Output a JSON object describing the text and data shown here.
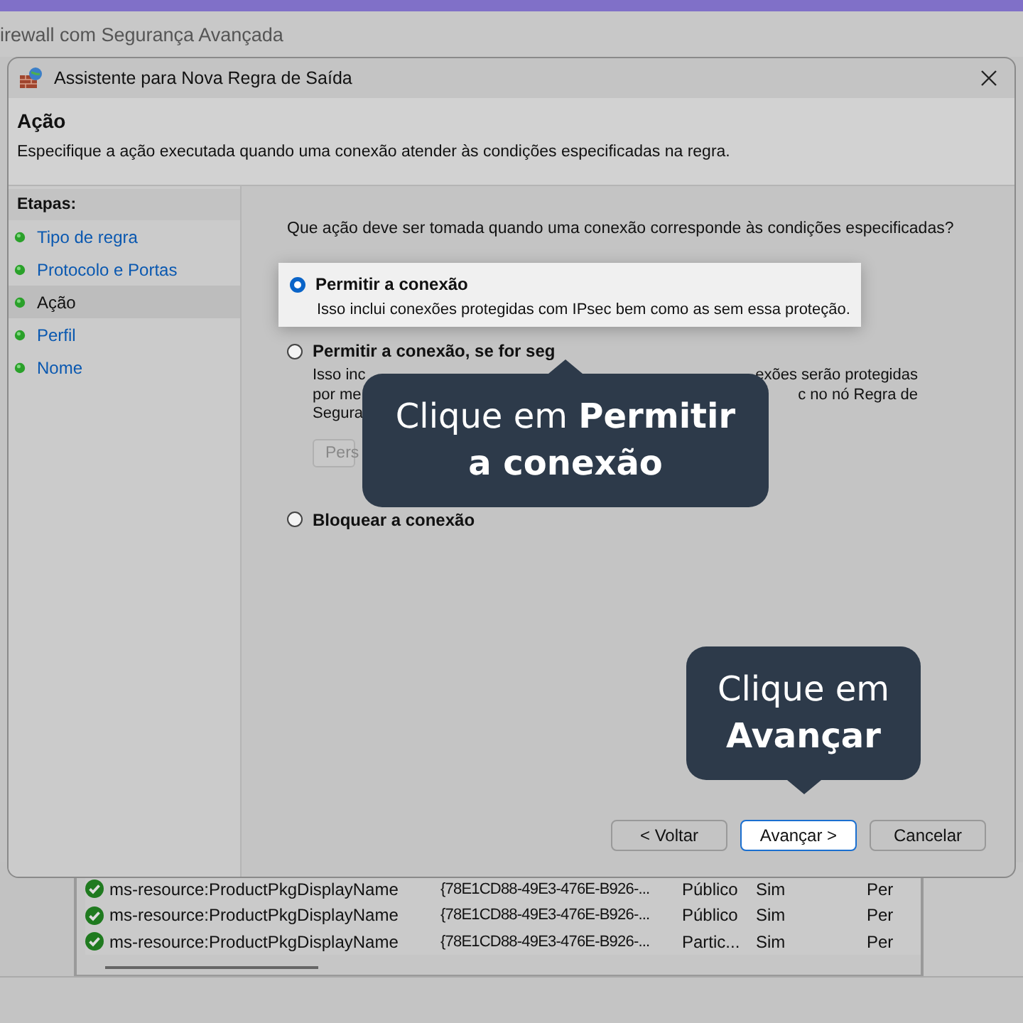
{
  "background_app": {
    "title": "irewall com Segurança Avançada",
    "rows": [
      {
        "name": "ms-resource:ProductPkgDisplayName",
        "id": "{78E1CD88-49E3-476E-B926-...",
        "profile": "Público",
        "enabled": "Sim",
        "action": "Per"
      },
      {
        "name": "ms-resource:ProductPkgDisplayName",
        "id": "{78E1CD88-49E3-476E-B926-...",
        "profile": "Público",
        "enabled": "Sim",
        "action": "Per"
      },
      {
        "name": "ms-resource:ProductPkgDisplayName",
        "id": "{78E1CD88-49E3-476E-B926-...",
        "profile": "Partic...",
        "enabled": "Sim",
        "action": "Per"
      }
    ]
  },
  "dialog": {
    "title": "Assistente para Nova Regra de Saída",
    "heading": "Ação",
    "description": "Especifique a ação executada quando uma conexão atender às condições especificadas na regra.",
    "steps_label": "Etapas:",
    "steps": [
      {
        "label": "Tipo de regra",
        "selected": false
      },
      {
        "label": "Protocolo e Portas",
        "selected": false
      },
      {
        "label": "Ação",
        "selected": true
      },
      {
        "label": "Perfil",
        "selected": false
      },
      {
        "label": "Nome",
        "selected": false
      }
    ],
    "question": "Que ação deve ser tomada quando uma conexão corresponde às condições especificadas?",
    "options": [
      {
        "label": "Permitir a conexão",
        "selected": true,
        "highlighted": true,
        "description": "Isso inclui conexões protegidas com IPsec bem como as sem essa proteção."
      },
      {
        "label": "Permitir a conexão, se for seg",
        "selected": false,
        "highlighted": false,
        "lines": [
          {
            "left": "Isso inc",
            "right": "exões serão protegidas"
          },
          {
            "left": "por me",
            "right": "c no nó Regra de"
          },
          {
            "left": "Segura"
          }
        ],
        "button": "Pers"
      },
      {
        "label": "Bloquear a conexão",
        "selected": false,
        "highlighted": false
      }
    ],
    "buttons": [
      {
        "label": "< Voltar",
        "highlighted": false
      },
      {
        "label": "Avançar >",
        "highlighted": true
      },
      {
        "label": "Cancelar",
        "highlighted": false
      }
    ]
  },
  "callouts": [
    {
      "text": "Clique em **Permitir a conexão**"
    },
    {
      "text": "Clique em **Avançar**"
    }
  ]
}
